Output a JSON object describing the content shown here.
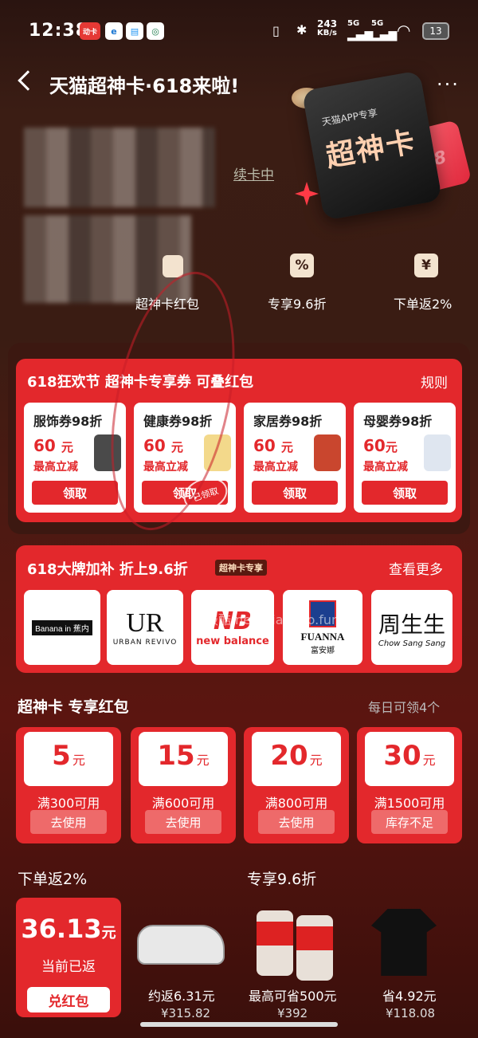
{
  "status": {
    "time": "12:38",
    "net_speed": "243",
    "net_unit": "KB/s",
    "sig1": "5G",
    "sig2": "5G",
    "battery": "13",
    "app_badge": "动卡"
  },
  "header": {
    "title": "天猫超神卡·618来啦!",
    "more": "···"
  },
  "profile": {
    "renew": "续卡中",
    "card_small": "天猫APP专享",
    "card_big": "超神卡",
    "card_618": "618"
  },
  "perks": [
    {
      "label": "超神卡红包",
      "icon": "red-packet"
    },
    {
      "label": "专享9.6折",
      "icon": "%"
    },
    {
      "label": "下单返2%",
      "icon": "¥"
    }
  ],
  "coupon_section": {
    "title": "618狂欢节 超神卡专享券 可叠红包",
    "rule": "规则",
    "items": [
      {
        "name": "服饰券98折",
        "amount": "60",
        "unit": "元",
        "sub": "最高立减",
        "button": "领取"
      },
      {
        "name": "健康券98折",
        "amount": "60",
        "unit": "元",
        "sub": "最高立减",
        "button": "领取"
      },
      {
        "name": "家居券98折",
        "amount": "60",
        "unit": "元",
        "sub": "最高立减",
        "button": "领取"
      },
      {
        "name": "母婴券98折",
        "amount": "60",
        "unit": "元",
        "sub": "最高立减",
        "button": "领取"
      }
    ],
    "stamp": "已领取"
  },
  "brand_section": {
    "title": "618大牌加补 折上9.6折",
    "tag": "超神卡专享",
    "more": "查看更多",
    "brands": [
      {
        "name": "Banana in 蕉内"
      },
      {
        "name": "UR",
        "sub": "URBAN REVIVO"
      },
      {
        "name": "NB",
        "sub": "new balance"
      },
      {
        "name": "FUANNA",
        "sub": "富安娜"
      },
      {
        "name": "周生生",
        "sub": "Chow Sang Sang"
      }
    ]
  },
  "watermark": "线报酷 new.xianbao.fun",
  "red_packets": {
    "title": "超神卡 专享红包",
    "sub": "每日可领4个",
    "items": [
      {
        "amount": "5",
        "unit": "元",
        "cond": "满300可用",
        "button": "去使用"
      },
      {
        "amount": "15",
        "unit": "元",
        "cond": "满600可用",
        "button": "去使用"
      },
      {
        "amount": "20",
        "unit": "元",
        "cond": "满800可用",
        "button": "去使用"
      },
      {
        "amount": "30",
        "unit": "元",
        "cond": "满1500可用",
        "button": "库存不足"
      }
    ]
  },
  "cashback": {
    "title": "下单返2%",
    "value": "36.13",
    "unit": "元",
    "label": "当前已返",
    "button": "兑红包"
  },
  "discount": {
    "title": "专享9.6折",
    "products": [
      {
        "label": "约返6.31元",
        "price": "¥315.82"
      },
      {
        "label": "最高可省500元",
        "price": "¥392"
      },
      {
        "label": "省4.92元",
        "price": "¥118.08"
      }
    ]
  }
}
